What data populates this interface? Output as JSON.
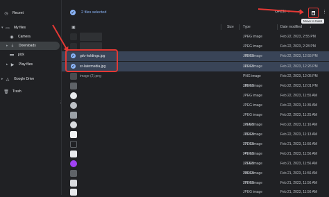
{
  "sidebar": {
    "recent": "Recent",
    "my_files": "My files",
    "camera": "Camera",
    "downloads": "Downloads",
    "pick": "pick",
    "play_files": "Play files",
    "google_drive": "Google Drive",
    "trash": "Trash"
  },
  "toolbar": {
    "selection_text": "2 files selected",
    "open_label": "OPEN",
    "tooltip": "Move to trash"
  },
  "columns": {
    "size": "Size",
    "type": "Type",
    "date": "Date modified"
  },
  "rows": [
    {
      "name": "",
      "size": "",
      "type": "",
      "date": ""
    },
    {
      "name": "",
      "size": "",
      "type": "JPEG image",
      "date": "Feb 22, 2023, 2:55 PM"
    },
    {
      "name": "",
      "size": "",
      "type": "JPEG image",
      "date": "Feb 22, 2023, 2:28 PM"
    },
    {
      "name": "gdv-holdings.jpg",
      "size": "89 KB",
      "type": "JPEG image",
      "date": "Feb 22, 2023, 12:55 PM"
    },
    {
      "name": "xr-latermedia.jpg",
      "size": "113 KB",
      "type": "JPEG image",
      "date": "Feb 22, 2023, 12:26 PM"
    },
    {
      "name": "image (2).png",
      "size": "",
      "type": "PNG image",
      "date": "Feb 22, 2023, 12:05 PM"
    },
    {
      "name": "",
      "size": "118 KB",
      "type": "JPEG image",
      "date": "Feb 22, 2023, 12:01 PM"
    },
    {
      "name": "",
      "size": "",
      "type": "JPEG image",
      "date": "Feb 22, 2023, 11:55 AM"
    },
    {
      "name": "",
      "size": "",
      "type": "JPEG image",
      "date": "Feb 22, 2023, 11:35 AM"
    },
    {
      "name": "",
      "size": "",
      "type": "JPEG image",
      "date": "Feb 22, 2023, 11:25 AM"
    },
    {
      "name": "",
      "size": "1.6 MB",
      "type": "JPEG image",
      "date": "Feb 22, 2023, 11:16 AM"
    },
    {
      "name": "",
      "size": "33 KB",
      "type": "JPEG image",
      "date": "Feb 22, 2023, 11:13 AM"
    },
    {
      "name": "",
      "size": "727 KB",
      "type": "JPEG image",
      "date": "Feb 21, 2023, 11:56 AM"
    },
    {
      "name": "",
      "size": "747 KB",
      "type": "JPEG image",
      "date": "Feb 21, 2023, 11:56 AM"
    },
    {
      "name": "",
      "size": "1.3 MB",
      "type": "JPEG image",
      "date": "Feb 21, 2023, 11:56 AM"
    },
    {
      "name": "",
      "size": "758 KB",
      "type": "JPEG image",
      "date": "Feb 21, 2023, 11:56 AM"
    },
    {
      "name": "",
      "size": "737 KB",
      "type": "JPEG image",
      "date": "Feb 21, 2023, 11:56 AM"
    },
    {
      "name": "",
      "size": "",
      "type": "JPEG image",
      "date": "Feb 21, 2023, 11:56 AM"
    }
  ]
}
